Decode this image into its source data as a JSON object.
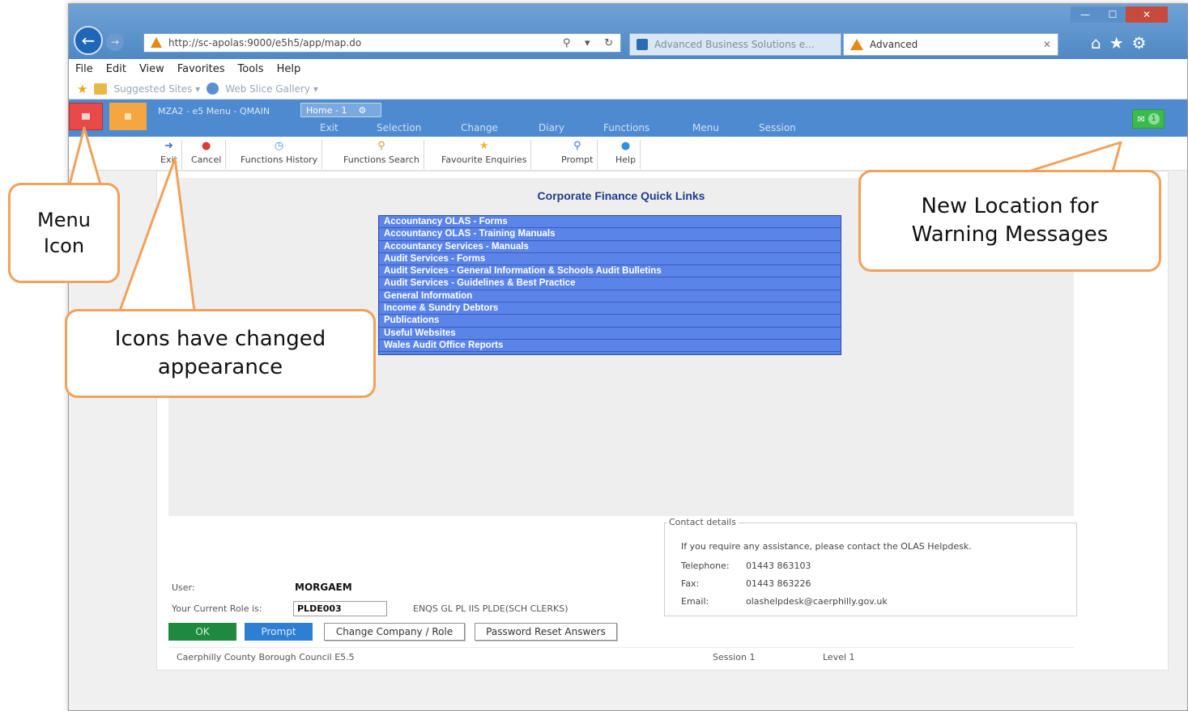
{
  "browser": {
    "address_url": "http://sc-apolas:9000/e5h5/app/map.do",
    "tabs": [
      {
        "label": "Advanced Business Solutions e..."
      },
      {
        "label": "Advanced"
      }
    ],
    "menu": [
      "File",
      "Edit",
      "View",
      "Favorites",
      "Tools",
      "Help"
    ],
    "favorites": [
      {
        "label": "Suggested Sites ▾"
      },
      {
        "label": "Web Slice Gallery ▾"
      }
    ]
  },
  "app": {
    "title": "MZA2 - e5 Menu - QMAIN",
    "home_tab": "Home - 1",
    "nav": [
      "Exit",
      "Selection",
      "Change",
      "Diary",
      "Functions",
      "Menu",
      "Session"
    ],
    "message_count": "1",
    "colors": {
      "bar": "#4d8ad0",
      "menu_button": "#e84a4a",
      "message_badge": "#3cba4d"
    }
  },
  "toolbar": [
    {
      "label": "Exit",
      "icon": "exit-arrow-icon"
    },
    {
      "label": "Cancel",
      "icon": "cancel-icon"
    },
    {
      "label": "Functions History",
      "icon": "history-clock-icon"
    },
    {
      "label": "Functions Search",
      "icon": "search-icon"
    },
    {
      "label": "Favourite Enquiries",
      "icon": "star-icon"
    },
    {
      "label": "Prompt",
      "icon": "magnifier-icon"
    },
    {
      "label": "Help",
      "icon": "help-icon"
    }
  ],
  "quick_links": {
    "title": "Corporate Finance Quick Links",
    "items": [
      "Accountancy OLAS - Forms",
      "Accountancy OLAS - Training Manuals",
      "Accountancy Services - Manuals",
      "Audit Services - Forms",
      "Audit Services - General Information & Schools Audit Bulletins",
      "Audit Services - Guidelines & Best Practice",
      "General Information",
      "Income & Sundry Debtors",
      "Publications",
      "Useful Websites",
      "Wales Audit Office Reports"
    ]
  },
  "contact": {
    "legend": "Contact details",
    "intro": "If you require any assistance, please contact the OLAS Helpdesk.",
    "rows": [
      {
        "label": "Telephone:",
        "value": "01443 863103"
      },
      {
        "label": "Fax:",
        "value": "01443 863226"
      },
      {
        "label": "Email:",
        "value": "olashelpdesk@caerphilly.gov.uk"
      }
    ]
  },
  "user": {
    "user_label": "User:",
    "user_value": "MORGAEM",
    "role_label": "Your Current Role is:",
    "role_value": "PLDE003",
    "role_desc": "ENQS GL PL IIS PLDE(SCH CLERKS)"
  },
  "buttons": {
    "ok": "OK",
    "prompt": "Prompt",
    "change_company": "Change Company / Role",
    "password_reset": "Password Reset Answers"
  },
  "footer": {
    "org": "Caerphilly County Borough Council E5.5",
    "session": "Session   1",
    "level": "Level    1"
  },
  "callouts": {
    "menu_icon": "Menu\nIcon",
    "icons_changed": "Icons have changed\nappearance",
    "warning_location": "New Location for\nWarning Messages",
    "border_color": "#f0a25a"
  }
}
